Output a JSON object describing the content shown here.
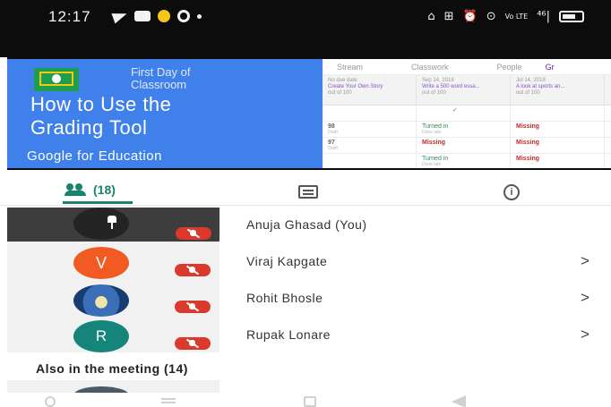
{
  "status_bar": {
    "time": "12:17",
    "right_glyphs": [
      "⌂",
      "⊞",
      "⏰",
      "⊙",
      "Vo LTE",
      "⁴⁶|",
      "▮▮"
    ],
    "icons": [
      "send-icon",
      "message-icon",
      "notification-dot-icon",
      "sync-icon",
      "more-dot-icon",
      "headset-icon",
      "vibrate-icon",
      "alarm-icon",
      "hotspot-icon",
      "volte-icon",
      "signal-icon",
      "battery-icon"
    ]
  },
  "video": {
    "slide": {
      "tag_line1": "First Day of",
      "tag_line2": "Classroom",
      "title_line1": "How to Use the",
      "title_line2": "Grading Tool",
      "brand": "Google for Education"
    },
    "grades": {
      "tabs": [
        "Stream",
        "Classwork",
        "People",
        "Gr"
      ],
      "columns": [
        {
          "due": "No due date",
          "title": "Create Your Own Story",
          "out_of": "out of 100"
        },
        {
          "due": "Sep 14, 2018",
          "title": "Write a 500 word essa...",
          "out_of": "out of 100"
        },
        {
          "due": "Jul 14, 2018",
          "title": "A look at sports an...",
          "out_of": "out of 100"
        }
      ],
      "rows": [
        {
          "score": "",
          "sub": "",
          "status": "✓",
          "status_sub": "",
          "third": ""
        },
        {
          "score": "98",
          "sub": "Draft",
          "status": "Turned in",
          "status_sub": "Done late",
          "third": "Missing"
        },
        {
          "score": "97",
          "sub": "Draft",
          "status": "Missing",
          "status_sub": "",
          "third": "Missing"
        },
        {
          "score": "",
          "sub": "",
          "status": "Turned in",
          "status_sub": "Done late",
          "third": "Missing"
        }
      ]
    }
  },
  "tabs": {
    "people_count": "(18)",
    "colors": {
      "accent": "#1a8370"
    }
  },
  "participants": [
    {
      "name": "Anuja Ghasad (You)",
      "initial": "",
      "avatar_color": "#242424",
      "chevron": ""
    },
    {
      "name": "Viraj Kapgate",
      "initial": "V",
      "avatar_color": "#f25a24",
      "chevron": ">"
    },
    {
      "name": "Rohit Bhosle",
      "initial": "",
      "avatar_color": "#3a6fb8",
      "chevron": ">"
    },
    {
      "name": "Rupak Lonare",
      "initial": "R",
      "avatar_color": "#15857b",
      "chevron": ">"
    }
  ],
  "also_in_meeting": "Also in the meeting (14)",
  "colors": {
    "mute_red": "#d93a2b",
    "slide_blue": "#3f80ea",
    "missing_red": "#c62828",
    "turned_in_green": "#2e8b57"
  }
}
